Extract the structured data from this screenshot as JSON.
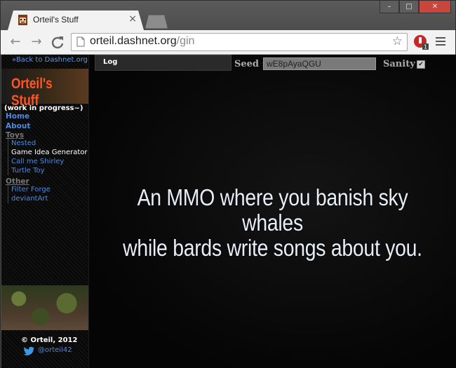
{
  "browser": {
    "tab_title": "Orteil's Stuff",
    "tab_close": "×",
    "url_host": "orteil.dashnet.org",
    "url_path": "/gin",
    "window_buttons": [
      "–",
      "□",
      "✕"
    ],
    "extension_badge": "1",
    "nav": {
      "back": "←",
      "forward": "→",
      "reload": "C"
    }
  },
  "sidebar": {
    "back_link": "«Back to Dashnet.org",
    "logo": "Orteil's Stuff",
    "wip": "(work in progress~)",
    "home": "Home",
    "about": "About",
    "toys_label": "Toys",
    "toys": [
      {
        "label": "Nested",
        "active": false
      },
      {
        "label": "Game Idea Generator",
        "active": true
      },
      {
        "label": "Call me Shirley",
        "active": false
      },
      {
        "label": "Turtle Toy",
        "active": false
      }
    ],
    "other_label": "Other",
    "other": [
      {
        "label": "Filter Forge"
      },
      {
        "label": "deviantArt"
      }
    ],
    "copyright": "© Orteil, 2012",
    "twitter": "@orteil42"
  },
  "controls": {
    "log_label": "Log",
    "seed_label": "Seed :",
    "seed_value": "wE8pAyaQGU",
    "sanity_label": "Sanity :",
    "sanity_checked": true
  },
  "idea": {
    "line1": "An MMO where you banish sky whales",
    "line2": "while bards write songs about you."
  }
}
